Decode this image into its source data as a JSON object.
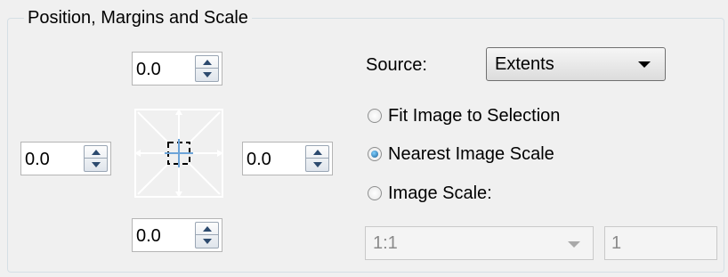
{
  "group": {
    "title": "Position, Margins and Scale"
  },
  "margins": {
    "top": "0.0",
    "left": "0.0",
    "right": "0.0",
    "bottom": "0.0"
  },
  "source": {
    "label": "Source:",
    "value": "Extents"
  },
  "options": [
    {
      "label": "Fit Image to Selection",
      "checked": false
    },
    {
      "label": "Nearest Image Scale",
      "checked": true
    },
    {
      "label": "Image Scale:",
      "checked": false
    }
  ],
  "image_scale": {
    "value": "1:1",
    "custom_value": "1"
  },
  "icons": {
    "spin_up": "arrow-up-icon",
    "spin_down": "arrow-down-icon",
    "dropdown": "chevron-down-icon",
    "anchor": "anchor-position-icon"
  },
  "colors": {
    "accent": "#1c5f96",
    "group_border": "#d5dfe5"
  }
}
